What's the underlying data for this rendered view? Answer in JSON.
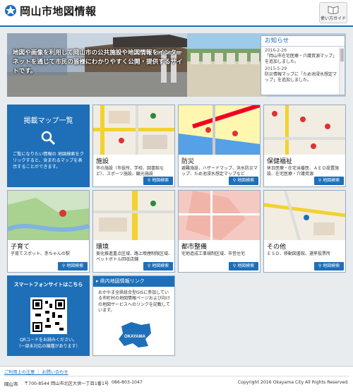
{
  "header": {
    "title": "岡山市地図情報",
    "guide_label": "使い方ガイド"
  },
  "hero": {
    "caption": "地図や画像を利用して岡山市の公共施設や地図情報をインターネットを通じて市民の皆様にわかりやすく公開・提供するサイトです。"
  },
  "news": {
    "title": "お知らせ",
    "items": [
      {
        "date": "2016-2-26",
        "text": "「岡山市在宅医療・介護資源マップ」を追加しました。"
      },
      {
        "date": "2015-5-29",
        "text": "防災情報マップに「ため池浸水想定マップ」を追加しました。"
      }
    ]
  },
  "map_list": {
    "title": "掲載マップ一覧",
    "text": "ご覧になりたい情報の 地図検索をクリックすると、含まれるマップを表示することができます。"
  },
  "search_label": "地図検索",
  "tiles": [
    {
      "name": "施設",
      "desc": "市の施設（市役所、学校、図書館など）、スポーツ施設、観光施設"
    },
    {
      "name": "防災",
      "desc": "避難施設、ハザードマップ、洪水防災マップ、ため池浸水想定マップなど"
    },
    {
      "name": "保健福祉",
      "desc": "休日医療・在宅当番医、ＡＥＤ設置施設、在宅医療・介護資源"
    },
    {
      "name": "子育て",
      "desc": "子育てスポット、赤ちゃんの駅"
    },
    {
      "name": "環境",
      "desc": "美化推進重点区域、路上喫煙制限区域、ペットボトル回収店舗"
    },
    {
      "name": "都市整備",
      "desc": "宅地造成工事規制区域、市営住宅"
    },
    {
      "name": "その他",
      "desc": "ＥＳＤ、移動図書館、選挙投票所"
    }
  ],
  "smartphone": {
    "title": "スマートフォンサイトはこちら",
    "text1": "QRコードをお読みください。",
    "text2": "（一部未対応の機種があります）"
  },
  "pref_link": {
    "title": "県内地図情報リンク",
    "text": "おかやま全県統合型GISに参加している市町村の地図情報ページおよび向けの地図サービスへのリンクを記載しています。",
    "logo_text": "OKAYAMA"
  },
  "footer": {
    "links": "ご利用上の注意 ｜ お問い合わせ",
    "city": "岡山市",
    "address": "〒700-8544 岡山市北区大供一丁目1番1号",
    "tel": "086-803-1047",
    "copyright": "Copyright 2016 Okayama City All Rights Reserved."
  },
  "colors": {
    "accent": "#1e6fb8",
    "road": "#f2d22e",
    "hazard": "#f20024"
  }
}
